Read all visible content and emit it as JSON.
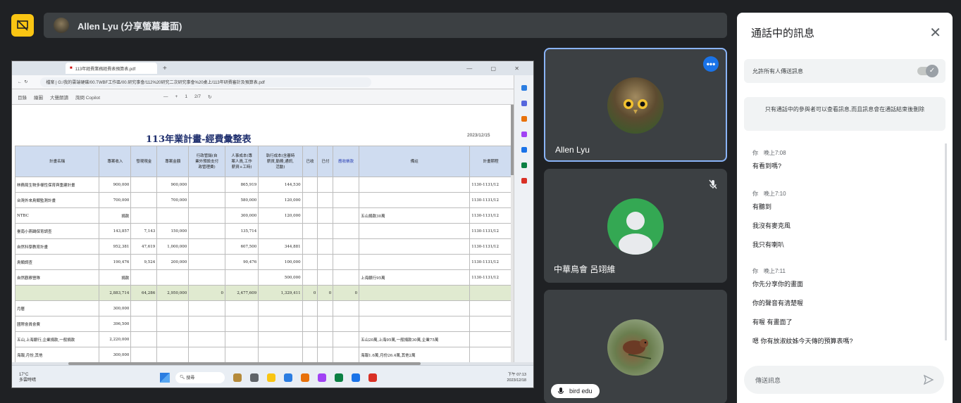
{
  "banner": {
    "title": "Allen Lyu (分享螢幕畫面)"
  },
  "browser": {
    "tab_title": "113年經費業務經費表預算表.pdf",
    "tab_plus": "+",
    "window_controls": "— ▢ ✕",
    "address": "檔案 | G:/我的雲端硬碟/00.TWBF工作區/00.研究事會/112%20研究二次研究事會%20桌上/113年研費審計及預算表.pdf",
    "pdf_tools": [
      "目錄",
      "繪圖",
      "大聲朗讀",
      "詢問 Copilot",
      "—",
      "+",
      "1",
      "2/7",
      "↻"
    ]
  },
  "document": {
    "title": "113年業計畫-經費彙整表",
    "date": "2023/12/15",
    "headers": [
      "計畫名稱",
      "專案收入",
      "發現現金",
      "專案金額",
      "行政管銷(自\n業外預設支付\n政管理費)",
      "人事成本(專\n案人員,工作\n薪資+工時)",
      "執行成本(含審時\n薪資,勤務,通訊,\n活動)",
      "已收",
      "已付",
      "應收帳款",
      "備註",
      "計畫期程"
    ],
    "rows": [
      [
        "林務局生物多樣性保育與重建計畫",
        "900,000",
        "",
        "900,000",
        "",
        "865,919",
        "144,530",
        "",
        "",
        "",
        "",
        "1130-1131/12"
      ],
      [
        "台灣外來鳥類監測計畫",
        "700,000",
        "",
        "700,000",
        "",
        "580,000",
        "120,000",
        "",
        "",
        "",
        "",
        "1130-1131/12"
      ],
      [
        "NTBC",
        "捐款",
        "",
        "",
        "",
        "300,000",
        "120,000",
        "",
        "",
        "",
        "五山捐款30萬",
        "1130-1131/12"
      ],
      [
        "臺南小燕鷗保育調查",
        "143,857",
        "7,143",
        "150,000",
        "",
        "135,714",
        "",
        "",
        "",
        "",
        "",
        "1130-1131/12"
      ],
      [
        "自然科學教育計畫",
        "952,381",
        "47,619",
        "1,000,000",
        "",
        "607,500",
        "344,881",
        "",
        "",
        "",
        "",
        "1130-1131/12"
      ],
      [
        "鳥類調查",
        "190,476",
        "9,524",
        "200,000",
        "",
        "90,476",
        "100,000",
        "",
        "",
        "",
        "",
        "1130-1131/12"
      ],
      [
        "自然觀察營隊",
        "捐款",
        "",
        "",
        "",
        "",
        "500,000",
        "",
        "",
        "",
        "上海銀行95萬",
        "1130-1131/12"
      ],
      [
        "",
        "2,883,714",
        "64,286",
        "2,950,000",
        "0",
        "2,477,609",
        "1,329,411",
        "0",
        "0",
        "0",
        "",
        ""
      ],
      [
        "月曆",
        "300,000",
        "",
        "",
        "",
        "",
        "",
        "",
        "",
        "",
        "",
        ""
      ],
      [
        "國際會員會費",
        "396,500",
        "",
        "",
        "",
        "",
        "",
        "",
        "",
        "",
        "",
        ""
      ],
      [
        "五山,上海銀行,企業捐款,一般捐款",
        "2,220,000",
        "",
        "",
        "",
        "",
        "",
        "",
        "",
        "",
        "五山20萬,上海95萬,一般捐款30萬,企業75萬",
        ""
      ],
      [
        "海報,月份,其他",
        "300,000",
        "",
        "",
        "",
        "",
        "",
        "",
        "",
        "",
        "海報1.6萬,月份26.4萬,其他2萬",
        ""
      ]
    ]
  },
  "taskbar": {
    "weather_temp": "17°C",
    "weather_desc": "多雲時晴",
    "search_placeholder": "搜尋",
    "time": "下午 07:13",
    "date": "2023/12/18"
  },
  "participants": [
    {
      "name": "Allen Lyu",
      "more": "•••"
    },
    {
      "name": "中華鳥會 呂翊維"
    },
    {
      "name": "bird edu"
    }
  ],
  "chat": {
    "title": "通話中的訊息",
    "close": "✕",
    "allow_label": "允許所有人傳送訊息",
    "notice": "只有通話中的參與者可以查看訊息,而且訊息會在通話結束後刪除",
    "groups": [
      {
        "sender": "你",
        "time": "晚上7:08",
        "messages": [
          "有看到嗎?"
        ]
      },
      {
        "sender": "你",
        "time": "晚上7:10",
        "messages": [
          "有聽到",
          "我沒有麥克風",
          "我只有喇叭"
        ]
      },
      {
        "sender": "你",
        "time": "晚上7:11",
        "messages": [
          "你先分享你的畫面",
          "你的聲音有清楚喔",
          "有喔 有畫面了",
          "嗯 你有放淑紋姊今天傳的預算表嗎?"
        ]
      }
    ],
    "input_placeholder": "傳送訊息"
  },
  "colors": {
    "accent": "#1a73e8",
    "present": "#f9c513",
    "tile": "#3c4043",
    "bg": "#1f2124"
  }
}
